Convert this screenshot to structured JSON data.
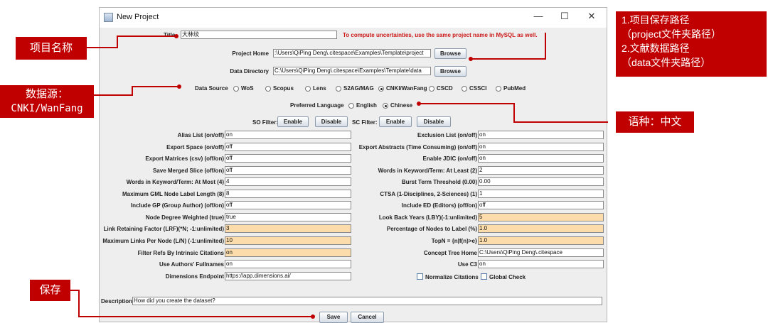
{
  "window": {
    "title": "New Project",
    "controls": {
      "minimize": "—",
      "maximize": "☐",
      "close": "✕"
    }
  },
  "project": {
    "title_label": "Title",
    "title_value": "大林纹",
    "warning": "To compute uncertainties, use the same project name in MySQL as well.",
    "home_label": "Project Home",
    "home_value": ":\\Users\\QiPing Deng\\.citespace\\Examples\\Template\\project",
    "data_label": "Data Directory",
    "data_value": "C:\\Users\\QiPing Deng\\.citespace\\Examples\\Template\\data",
    "browse_label": "Browse"
  },
  "data_source": {
    "label": "Data Source",
    "options": [
      "WoS",
      "Scopus",
      "Lens",
      "S2AG/MAG",
      "CNKI/WanFang",
      "CSCD",
      "CSSCI",
      "PubMed"
    ],
    "selected": "CNKI/WanFang"
  },
  "language": {
    "label": "Preferred Language",
    "options": [
      "English",
      "Chinese"
    ],
    "selected": "Chinese"
  },
  "filters": {
    "so_label": "SO Filter:",
    "sc_label": "SC Filter:",
    "enable": "Enable",
    "disable": "Disable"
  },
  "left_params": [
    {
      "label": "Alias List (on/off)",
      "value": "on",
      "highlight": false
    },
    {
      "label": "Export Space (on/off)",
      "value": "off",
      "highlight": false
    },
    {
      "label": "Export Matrices (csv) (off/on)",
      "value": "off",
      "highlight": false
    },
    {
      "label": "Save Merged Slice (off/on)",
      "value": "off",
      "highlight": false
    },
    {
      "label": "Words in Keyword/Term: At Most (4)",
      "value": "4",
      "highlight": false
    },
    {
      "label": "Maximum GML Node Label Length (8)",
      "value": "8",
      "highlight": false
    },
    {
      "label": "Include GP (Group Author) (off/on)",
      "value": "off",
      "highlight": false
    },
    {
      "label": "Node Degree Weighted (true)",
      "value": "true",
      "highlight": false
    },
    {
      "label": "Link Retaining Factor (LRF)(*N; -1:unlimited)",
      "value": "3",
      "highlight": true
    },
    {
      "label": "Maximum Links Per Node (L/N) (-1:unlimited)",
      "value": "10",
      "highlight": true
    },
    {
      "label": "Filter Refs By Intrinsic Citations",
      "value": "on",
      "highlight": true
    },
    {
      "label": "Use Authors' Fullnames",
      "value": "on",
      "highlight": false
    },
    {
      "label": "Dimensions Endpoint",
      "value": "https://app.dimensions.ai/",
      "highlight": false
    }
  ],
  "right_params": [
    {
      "label": "Exclusion List (on/off)",
      "value": "on",
      "highlight": false
    },
    {
      "label": "Export Abstracts (Time Consuming) (on/off)",
      "value": "on",
      "highlight": false
    },
    {
      "label": "Enable JDIC (on/off)",
      "value": "on",
      "highlight": false
    },
    {
      "label": "Words in Keyword/Term: At Least (2)",
      "value": "2",
      "highlight": false
    },
    {
      "label": "Burst Term Threshold (0.00)",
      "value": "0.00",
      "highlight": false
    },
    {
      "label": "CTSA (1-Disciplines, 2-Sciences) (1)",
      "value": "1",
      "highlight": false
    },
    {
      "label": "Include ED (Editors) (off/on)",
      "value": "off",
      "highlight": false
    },
    {
      "label": "Look Back Years (LBY)(-1:unlimited)",
      "value": "5",
      "highlight": true
    },
    {
      "label": "Percentage of Nodes to Label (%)",
      "value": "1.0",
      "highlight": true
    },
    {
      "label": "TopN = {n|f(n)>e}",
      "value": "1.0",
      "highlight": true
    },
    {
      "label": "Concept Tree Home",
      "value": "C:\\Users\\QiPing Deng\\.citespace",
      "highlight": false
    },
    {
      "label": "Use C3",
      "value": "on",
      "highlight": false
    }
  ],
  "checks": {
    "normalize": "Normalize Citations",
    "global": "Global Check"
  },
  "description": {
    "label": "Description",
    "value": "How did you create the dataset?"
  },
  "actions": {
    "save": "Save",
    "cancel": "Cancel"
  },
  "annotations": {
    "project_name": "项目名称",
    "data_source": [
      "数据源：",
      "CNKI/WanFang"
    ],
    "paths": [
      "1.项目保存路径",
      "（project文件夹路径）",
      "2.文献数据路径",
      "（data文件夹路径）"
    ],
    "language": "语种：中文",
    "save": "保存",
    "color": "#c00000"
  }
}
